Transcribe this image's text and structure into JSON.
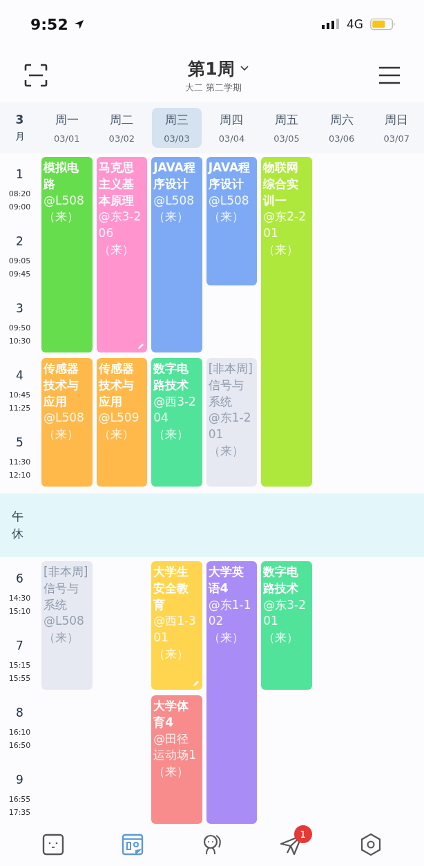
{
  "status_bar": {
    "time": "9:52",
    "network": "4G"
  },
  "header": {
    "title": "第1周",
    "subtitle": "大二 第二学期"
  },
  "month": {
    "number": "3",
    "unit": "月"
  },
  "days": [
    {
      "name": "周一",
      "date": "03/01",
      "selected": false
    },
    {
      "name": "周二",
      "date": "03/02",
      "selected": false
    },
    {
      "name": "周三",
      "date": "03/03",
      "selected": true
    },
    {
      "name": "周四",
      "date": "03/04",
      "selected": false
    },
    {
      "name": "周五",
      "date": "03/05",
      "selected": false
    },
    {
      "name": "周六",
      "date": "03/06",
      "selected": false
    },
    {
      "name": "周日",
      "date": "03/07",
      "selected": false
    }
  ],
  "periods": [
    {
      "number": "1",
      "start": "08:20",
      "end": "09:00"
    },
    {
      "number": "2",
      "start": "09:05",
      "end": "09:45"
    },
    {
      "number": "3",
      "start": "09:50",
      "end": "10:30"
    },
    {
      "number": "4",
      "start": "10:45",
      "end": "11:25"
    },
    {
      "number": "5",
      "start": "11:30",
      "end": "12:10"
    },
    {
      "number": "6",
      "start": "14:30",
      "end": "15:10"
    },
    {
      "number": "7",
      "start": "15:15",
      "end": "15:55"
    },
    {
      "number": "8",
      "start": "16:10",
      "end": "16:50"
    },
    {
      "number": "9",
      "start": "16:55",
      "end": "17:35"
    }
  ],
  "break": {
    "label": "午休"
  },
  "courses": [
    {
      "name": "模拟电路",
      "location": "@L508（来）",
      "color": "#66dd4c",
      "this_week": true,
      "edited": false
    },
    {
      "name": "传感器技术与应用",
      "location": "@L508（来）",
      "color": "#ffb84a",
      "this_week": true,
      "edited": false
    },
    {
      "name": "[非本周]信号与系统",
      "location": "@L508（来）",
      "color": "#e6e9f1",
      "this_week": false,
      "edited": false
    },
    {
      "name": "马克思主义基本原理",
      "location": "@东3-206（来）",
      "color": "#ff94cf",
      "this_week": true,
      "edited": true
    },
    {
      "name": "传感器技术与应用",
      "location": "@L509（来）",
      "color": "#ffb84a",
      "this_week": true,
      "edited": false
    },
    {
      "name": "JAVA程序设计",
      "location": "@L508（来）",
      "color": "#7eaaf5",
      "this_week": true,
      "edited": false
    },
    {
      "name": "数字电路技术",
      "location": "@西3-204（来）",
      "color": "#52e39b",
      "this_week": true,
      "edited": false
    },
    {
      "name": "大学生安全教育",
      "location": "@西1-301（来）",
      "color": "#ffd54f",
      "this_week": true,
      "edited": true
    },
    {
      "name": "大学体育4",
      "location": "@田径运动场1（来）",
      "color": "#f88b8b",
      "this_week": true,
      "edited": false
    },
    {
      "name": "JAVA程序设计",
      "location": "@L508（来）",
      "color": "#7eaaf5",
      "this_week": true,
      "edited": false
    },
    {
      "name": "[非本周]信号与系统",
      "location": "@东1-201（来）",
      "color": "#e6e9f1",
      "this_week": false,
      "edited": false
    },
    {
      "name": "大学英语4",
      "location": "@东1-102（来）",
      "color": "#a98cf5",
      "this_week": true,
      "edited": false
    },
    {
      "name": "物联网综合实训一",
      "location": "@东2-201（来）",
      "color": "#aee83c",
      "this_week": true,
      "edited": false
    },
    {
      "name": "数字电路技术",
      "location": "@东3-201（来）",
      "color": "#52e39b",
      "this_week": true,
      "edited": false
    }
  ],
  "nav": [
    {
      "kind": "face",
      "selected": false
    },
    {
      "kind": "schedule",
      "selected": true
    },
    {
      "kind": "people",
      "selected": false
    },
    {
      "kind": "send",
      "selected": false,
      "badge": "1"
    },
    {
      "kind": "hexagon",
      "selected": false
    }
  ]
}
